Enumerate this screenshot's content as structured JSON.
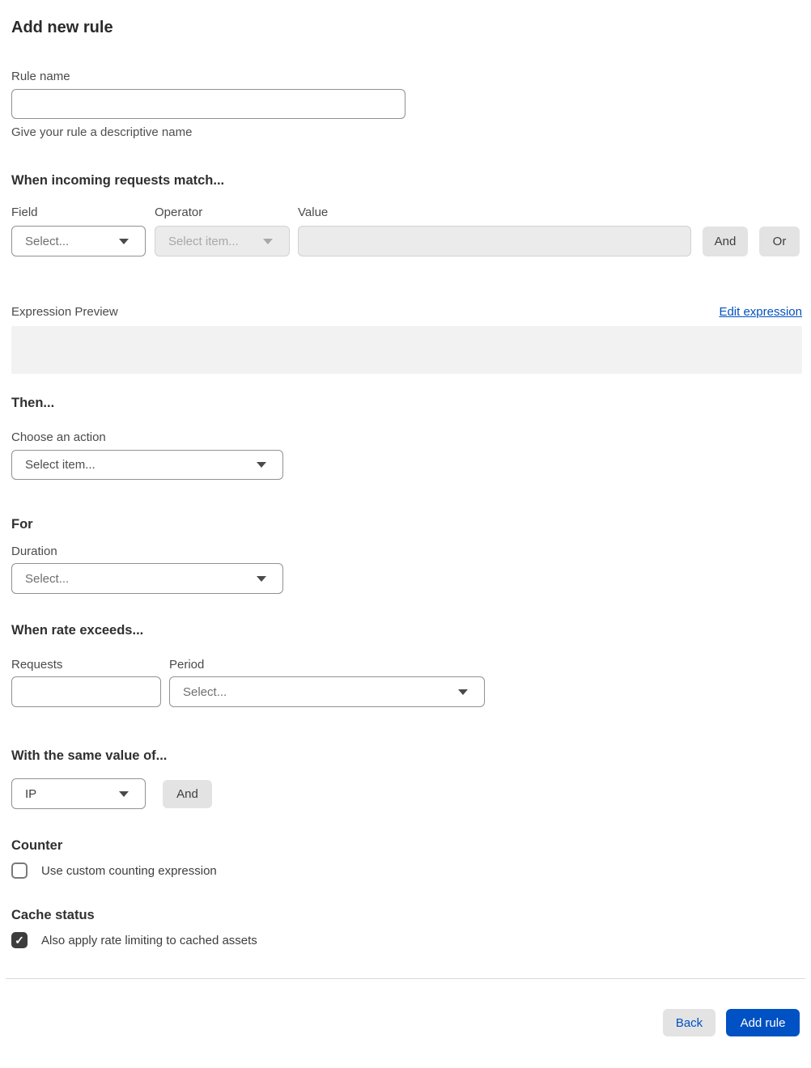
{
  "page": {
    "title": "Add new rule"
  },
  "rule_name": {
    "label": "Rule name",
    "value": "",
    "helper": "Give your rule a descriptive name"
  },
  "match": {
    "heading": "When incoming requests match...",
    "field": {
      "label": "Field",
      "placeholder": "Select..."
    },
    "operator": {
      "label": "Operator",
      "placeholder": "Select item..."
    },
    "value": {
      "label": "Value",
      "value": ""
    },
    "and_button": "And",
    "or_button": "Or"
  },
  "expression": {
    "label": "Expression Preview",
    "edit_link": "Edit expression",
    "preview": ""
  },
  "then_section": {
    "heading": "Then...",
    "action_label": "Choose an action",
    "action_placeholder": "Select item..."
  },
  "for_section": {
    "heading": "For",
    "duration_label": "Duration",
    "duration_placeholder": "Select..."
  },
  "rate_section": {
    "heading": "When rate exceeds...",
    "requests_label": "Requests",
    "requests_value": "",
    "period_label": "Period",
    "period_placeholder": "Select..."
  },
  "same_value_section": {
    "heading": "With the same value of...",
    "selected_value": "IP",
    "and_button": "And"
  },
  "counter_section": {
    "heading": "Counter",
    "checkbox_label": "Use custom counting expression",
    "checked": false,
    "check_glyph": "✓"
  },
  "cache_section": {
    "heading": "Cache status",
    "checkbox_label": "Also apply rate limiting to cached assets",
    "checked": true,
    "check_glyph": "✓"
  },
  "footer": {
    "back_button": "Back",
    "add_button": "Add rule"
  },
  "colors": {
    "primary_blue": "#0051c3",
    "checkbox_checked": "#3d3d3d",
    "disabled_bg": "#ebebeb",
    "preview_bg": "#f2f2f2",
    "button_gray": "#e3e3e3"
  }
}
